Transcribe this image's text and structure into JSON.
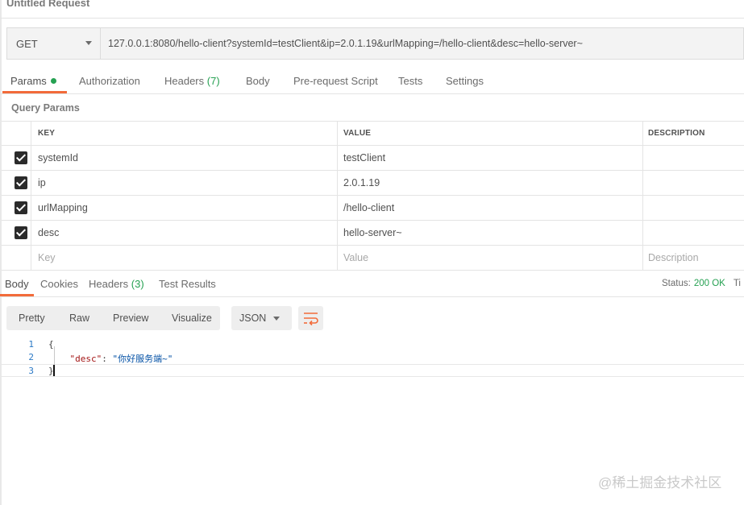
{
  "request": {
    "title": "Untitled Request",
    "method": "GET",
    "url": "127.0.0.1:8080/hello-client?systemId=testClient&ip=2.0.1.19&urlMapping=/hello-client&desc=hello-server~"
  },
  "request_tabs": [
    {
      "label": "Params",
      "count": ""
    },
    {
      "label": "Authorization",
      "count": ""
    },
    {
      "label": "Headers",
      "count": "(7)"
    },
    {
      "label": "Body",
      "count": ""
    },
    {
      "label": "Pre-request Script",
      "count": ""
    },
    {
      "label": "Tests",
      "count": ""
    },
    {
      "label": "Settings",
      "count": ""
    }
  ],
  "query_params": {
    "title": "Query Params",
    "headers": {
      "key": "KEY",
      "value": "VALUE",
      "description": "DESCRIPTION"
    },
    "rows": [
      {
        "key": "systemId",
        "value": "testClient"
      },
      {
        "key": "ip",
        "value": "2.0.1.19"
      },
      {
        "key": "urlMapping",
        "value": "/hello-client"
      },
      {
        "key": "desc",
        "value": "hello-server~"
      }
    ],
    "placeholders": {
      "key": "Key",
      "value": "Value",
      "description": "Description"
    }
  },
  "response_tabs": [
    {
      "label": "Body",
      "count": ""
    },
    {
      "label": "Cookies",
      "count": ""
    },
    {
      "label": "Headers",
      "count": "(3)"
    },
    {
      "label": "Test Results",
      "count": ""
    }
  ],
  "status": {
    "label": "Status:",
    "value": "200 OK",
    "next": "Ti"
  },
  "view_modes": [
    "Pretty",
    "Raw",
    "Preview",
    "Visualize"
  ],
  "format": "JSON",
  "code": {
    "line_numbers": [
      "1",
      "2",
      "3"
    ],
    "open_brace": "{",
    "indent": "    ",
    "key": "\"desc\"",
    "colon": ": ",
    "value": "\"你好服务端~\"",
    "close_brace": "}"
  },
  "watermark": "@稀土掘金技术社区",
  "colors": {
    "accent": "#f26b3a",
    "success": "#26a152",
    "line_number": "#2a78c5"
  },
  "icons": [
    "dropdown-caret-icon",
    "checkbox-checked-icon",
    "wrap-lines-icon"
  ]
}
